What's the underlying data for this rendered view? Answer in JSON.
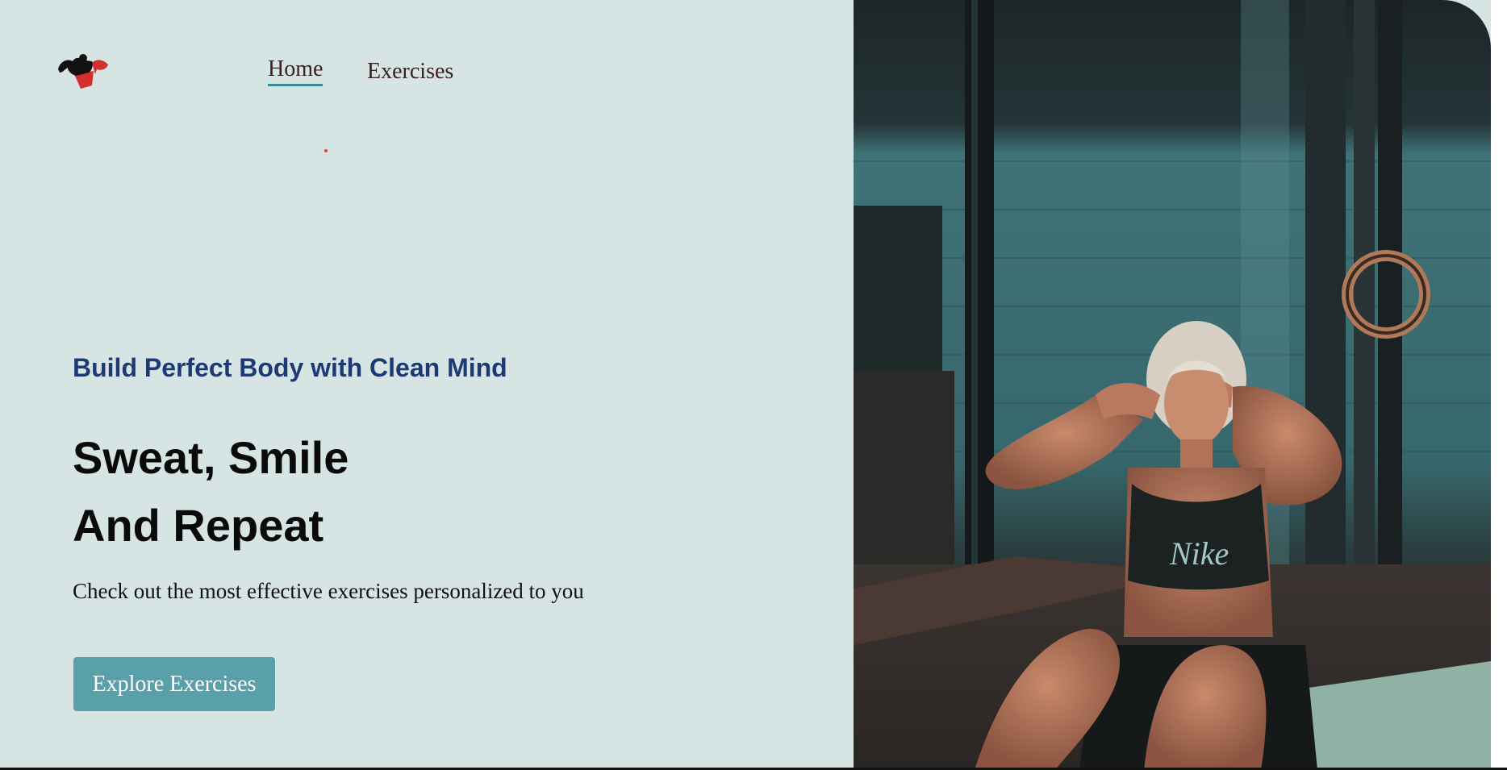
{
  "nav": {
    "logo": "gym-logo",
    "links": [
      {
        "label": "Home",
        "active": true
      },
      {
        "label": "Exercises",
        "active": false
      }
    ]
  },
  "hero": {
    "tagline": "Build Perfect Body with Clean Mind",
    "headline_line1": "Sweat, Smile",
    "headline_line2": "And Repeat",
    "subtext": "Check out the most effective exercises personalized to you",
    "cta_label": "Explore Exercises",
    "image_alt": "woman-doing-sit-ups-in-gym",
    "shirt_text": "Nike"
  },
  "colors": {
    "background": "#d6e4e4",
    "tagline": "#1e3a73",
    "cta": "#5aa0ab",
    "active_underline": "#3a8c99",
    "logo_red": "#d32f2f"
  }
}
